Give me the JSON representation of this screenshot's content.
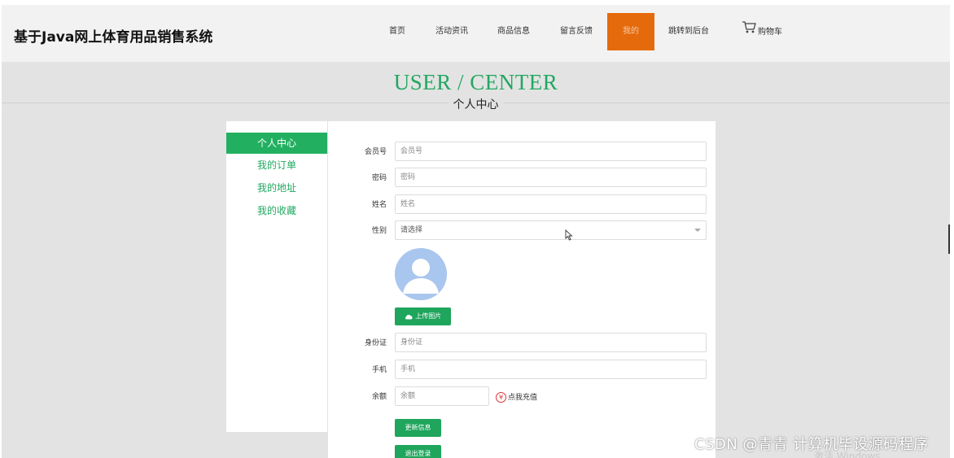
{
  "site": {
    "title": "基于Java网上体育用品销售系统"
  },
  "nav": {
    "items": [
      {
        "label": "首页"
      },
      {
        "label": "活动资讯"
      },
      {
        "label": "商品信息"
      },
      {
        "label": "留言反馈"
      },
      {
        "label": "我的",
        "active": true
      },
      {
        "label": "跳转到后台"
      },
      {
        "label": "购物车",
        "icon": "cart-icon"
      }
    ],
    "active_color": "#e56a0b"
  },
  "hero": {
    "title_en": "USER / CENTER",
    "title_cn": "个人中心"
  },
  "sidebar": {
    "items": [
      {
        "label": "个人中心",
        "active": true
      },
      {
        "label": "我的订单"
      },
      {
        "label": "我的地址"
      },
      {
        "label": "我的收藏"
      }
    ],
    "accent_color": "#22a861"
  },
  "form": {
    "member_no": {
      "label": "会员号",
      "placeholder": "会员号"
    },
    "password": {
      "label": "密码",
      "placeholder": "密码"
    },
    "name": {
      "label": "姓名",
      "placeholder": "姓名"
    },
    "gender": {
      "label": "性别",
      "placeholder": "请选择"
    },
    "upload_label": "上传图片",
    "id_card": {
      "label": "身份证",
      "placeholder": "身份证"
    },
    "phone": {
      "label": "手机",
      "placeholder": "手机"
    },
    "balance": {
      "label": "余额",
      "placeholder": "余额"
    },
    "recharge_label": "点我充值",
    "update_label": "更新信息",
    "logout_label": "退出登录"
  },
  "watermark": {
    "text": "CSDN @青青  计算机毕设源码程序",
    "windows": "激活 Windows"
  }
}
